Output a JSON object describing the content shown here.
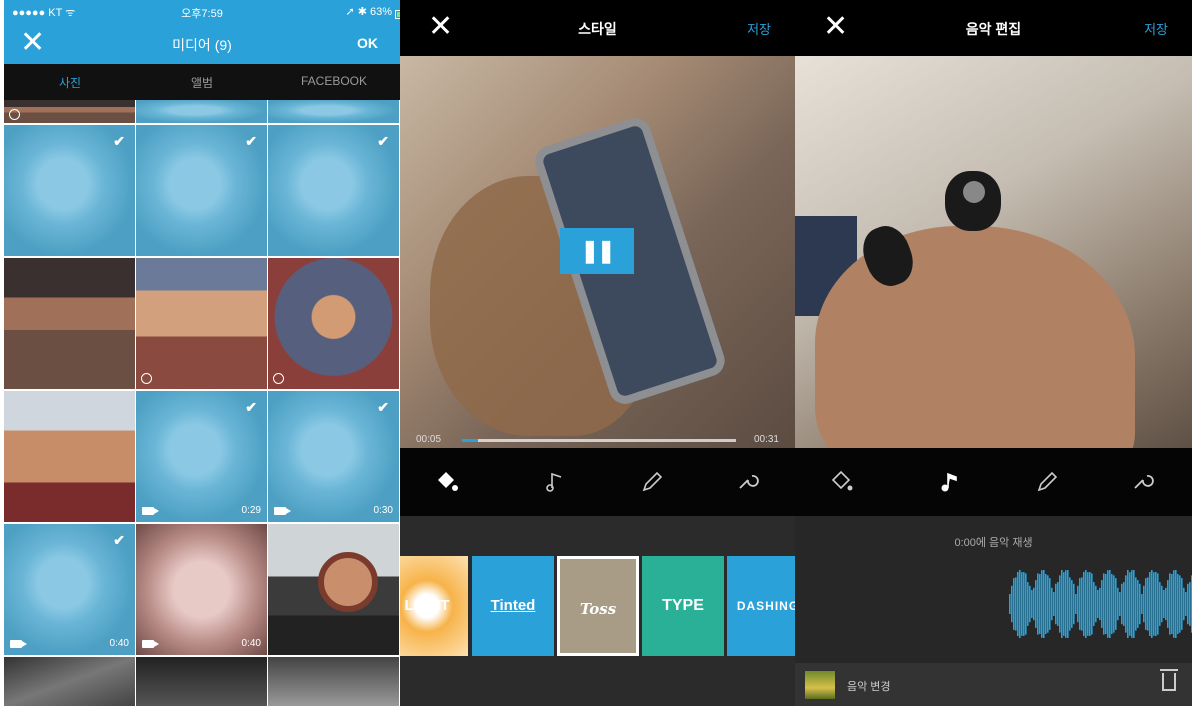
{
  "panel1": {
    "status": {
      "carrier": "●●●●● KT ᯤ",
      "time": "오후7:59",
      "right": "➚ ✱ 63%"
    },
    "nav": {
      "close": "✕",
      "title": "미디어 (9)",
      "ok": "OK"
    },
    "tabs": [
      "사진",
      "앨범",
      "FACEBOOK"
    ],
    "grid": {
      "check": "✔",
      "durations": [
        "0:29",
        "0:30",
        "0:40",
        "0:40"
      ]
    }
  },
  "panel2": {
    "nav": {
      "close": "✕",
      "title": "스타일",
      "save": "저장"
    },
    "player": {
      "pause": "❚❚",
      "current": "00:05",
      "total": "00:31",
      "progress": 0.06
    },
    "tools": [
      "paint-bucket-icon",
      "music-note-icon",
      "pencil-icon",
      "wrench-icon"
    ],
    "styles": [
      "LIGHT",
      "Tinted",
      "Toss",
      "TYPE",
      "DASHING"
    ]
  },
  "panel3": {
    "nav": {
      "close": "✕",
      "title": "음악 편집",
      "save": "저장"
    },
    "music": {
      "play_text": "0:00에 음악 재생"
    },
    "bottom": {
      "change_label": "음악 변경"
    }
  },
  "colors": {
    "accent": "#2aa1d8",
    "teal": "#29b097"
  }
}
